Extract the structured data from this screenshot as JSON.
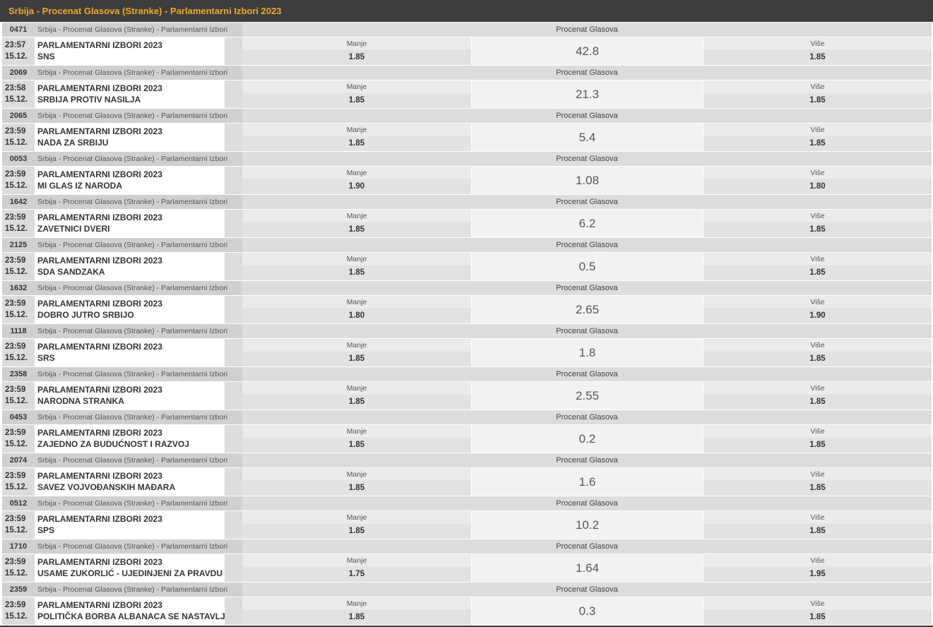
{
  "header": {
    "title": "Srbija - Procenat Glasova (Stranke) - Parlamentarni Izbori 2023"
  },
  "labels": {
    "market": "Procenat Glasova",
    "under": "Manje",
    "over": "Više"
  },
  "colors": {
    "title_bg": "#3d3d3d",
    "title_text": "#f5a623"
  },
  "matches": [
    {
      "code": "0471",
      "league": "Srbija - Procenat Glasova (Stranke) - Parlamentarni Izbori 2...",
      "time": "23:57",
      "date": "15.12.",
      "event": "PARLAMENTARNI IZBORI 2023",
      "party": "SNS",
      "under": "1.85",
      "line": "42.8",
      "over": "1.85"
    },
    {
      "code": "2069",
      "league": "Srbija - Procenat Glasova (Stranke) - Parlamentarni Izbori 2...",
      "time": "23:58",
      "date": "15.12.",
      "event": "PARLAMENTARNI IZBORI 2023",
      "party": "SRBIJA PROTIV NASILJA",
      "under": "1.85",
      "line": "21.3",
      "over": "1.85"
    },
    {
      "code": "2065",
      "league": "Srbija - Procenat Glasova (Stranke) - Parlamentarni Izbori 2...",
      "time": "23:59",
      "date": "15.12.",
      "event": "PARLAMENTARNI IZBORI 2023",
      "party": "NADA ZA SRBIJU",
      "under": "1.85",
      "line": "5.4",
      "over": "1.85"
    },
    {
      "code": "0053",
      "league": "Srbija - Procenat Glasova (Stranke) - Parlamentarni Izbori 2...",
      "time": "23:59",
      "date": "15.12.",
      "event": "PARLAMENTARNI IZBORI 2023",
      "party": "MI GLAS IZ NARODA",
      "under": "1.90",
      "line": "1.08",
      "over": "1.80"
    },
    {
      "code": "1642",
      "league": "Srbija - Procenat Glasova (Stranke) - Parlamentarni Izbori 2...",
      "time": "23:59",
      "date": "15.12.",
      "event": "PARLAMENTARNI IZBORI 2023",
      "party": "ZAVETNICI DVERI",
      "under": "1.85",
      "line": "6.2",
      "over": "1.85"
    },
    {
      "code": "2125",
      "league": "Srbija - Procenat Glasova (Stranke) - Parlamentarni Izbori 2...",
      "time": "23:59",
      "date": "15.12.",
      "event": "PARLAMENTARNI IZBORI 2023",
      "party": "SDA SANDZAKA",
      "under": "1.85",
      "line": "0.5",
      "over": "1.85"
    },
    {
      "code": "1632",
      "league": "Srbija - Procenat Glasova (Stranke) - Parlamentarni Izbori 2...",
      "time": "23:59",
      "date": "15.12.",
      "event": "PARLAMENTARNI IZBORI 2023",
      "party": "DOBRO JUTRO SRBIJO",
      "under": "1.80",
      "line": "2.65",
      "over": "1.90"
    },
    {
      "code": "1118",
      "league": "Srbija - Procenat Glasova (Stranke) - Parlamentarni Izbori 2...",
      "time": "23:59",
      "date": "15.12.",
      "event": "PARLAMENTARNI IZBORI 2023",
      "party": "SRS",
      "under": "1.85",
      "line": "1.8",
      "over": "1.85"
    },
    {
      "code": "2358",
      "league": "Srbija - Procenat Glasova (Stranke) - Parlamentarni Izbori 2...",
      "time": "23:59",
      "date": "15.12.",
      "event": "PARLAMENTARNI IZBORI 2023",
      "party": "NARODNA STRANKA",
      "under": "1.85",
      "line": "2.55",
      "over": "1.85"
    },
    {
      "code": "0453",
      "league": "Srbija - Procenat Glasova (Stranke) - Parlamentarni Izbori 2...",
      "time": "23:59",
      "date": "15.12.",
      "event": "PARLAMENTARNI IZBORI 2023",
      "party": "ZAJEDNO ZA BUDUĆNOST I RAZVOJ",
      "under": "1.85",
      "line": "0.2",
      "over": "1.85"
    },
    {
      "code": "2074",
      "league": "Srbija - Procenat Glasova (Stranke) - Parlamentarni Izbori 2...",
      "time": "23:59",
      "date": "15.12.",
      "event": "PARLAMENTARNI IZBORI 2023",
      "party": "SAVEZ VOJVOĐANSKIH MAĐARA",
      "under": "1.85",
      "line": "1.6",
      "over": "1.85"
    },
    {
      "code": "0512",
      "league": "Srbija - Procenat Glasova (Stranke) - Parlamentarni Izbori 2...",
      "time": "23:59",
      "date": "15.12.",
      "event": "PARLAMENTARNI IZBORI 2023",
      "party": "SPS",
      "under": "1.85",
      "line": "10.2",
      "over": "1.85"
    },
    {
      "code": "1710",
      "league": "Srbija - Procenat Glasova (Stranke) - Parlamentarni Izbori 2...",
      "time": "23:59",
      "date": "15.12.",
      "event": "PARLAMENTARNI IZBORI 2023",
      "party": "USAME ZUKORLIĆ - UJEDINJENI ZA PRAVDU",
      "under": "1.75",
      "line": "1.64",
      "over": "1.95"
    },
    {
      "code": "2359",
      "league": "Srbija - Procenat Glasova (Stranke) - Parlamentarni Izbori 2...",
      "time": "23:59",
      "date": "15.12.",
      "event": "PARLAMENTARNI IZBORI 2023",
      "party": "POLITIČKA BORBA ALBANACA SE NASTAVLJA",
      "under": "1.85",
      "line": "0.3",
      "over": "1.85"
    }
  ]
}
